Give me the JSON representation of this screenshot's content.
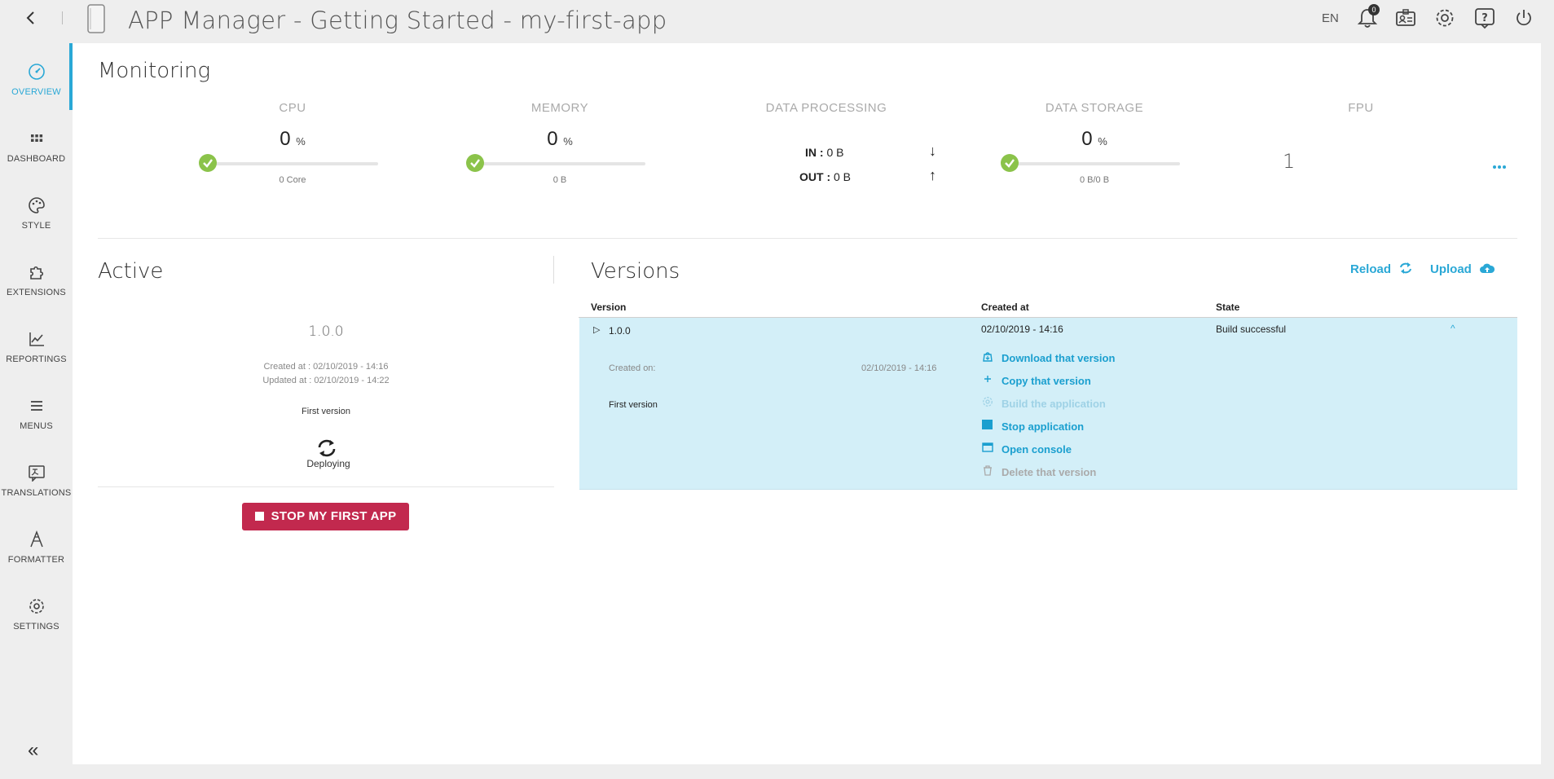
{
  "header": {
    "title": "APP Manager - Getting Started - my-first-app",
    "language": "EN",
    "notifications_count": "0"
  },
  "sidebar": {
    "items": [
      {
        "label": "OVERVIEW",
        "icon": "gauge-icon",
        "active": true
      },
      {
        "label": "DASHBOARD",
        "icon": "grid-icon"
      },
      {
        "label": "STYLE",
        "icon": "palette-icon"
      },
      {
        "label": "EXTENSIONS",
        "icon": "puzzle-icon"
      },
      {
        "label": "REPORTINGS",
        "icon": "chart-line-icon"
      },
      {
        "label": "MENUS",
        "icon": "menu-icon"
      },
      {
        "label": "TRANSLATIONS",
        "icon": "translate-icon"
      },
      {
        "label": "FORMATTER",
        "icon": "formatter-icon"
      },
      {
        "label": "SETTINGS",
        "icon": "gear-icon"
      }
    ],
    "collapse_label": "«"
  },
  "monitoring": {
    "title": "Monitoring",
    "cpu": {
      "label": "CPU",
      "value": "0",
      "unit": "%",
      "sub": "0 Core"
    },
    "memory": {
      "label": "MEMORY",
      "value": "0",
      "unit": "%",
      "sub": "0 B"
    },
    "data_processing": {
      "label": "DATA PROCESSING",
      "in_label": "IN :",
      "in_value": "0 B",
      "out_label": "OUT :",
      "out_value": "0 B",
      "in_arrow": "↓",
      "out_arrow": "↑"
    },
    "data_storage": {
      "label": "DATA STORAGE",
      "value": "0",
      "unit": "%",
      "sub": "0 B/0 B"
    },
    "fpu": {
      "label": "FPU",
      "value": "1"
    },
    "more": "•••"
  },
  "active": {
    "title": "Active",
    "version": "1.0.0",
    "created_at": "Created at  : 02/10/2019 - 14:16",
    "updated_at": "Updated at : 02/10/2019 - 14:22",
    "description": "First version",
    "status": "Deploying",
    "stop_button": "STOP MY FIRST APP"
  },
  "versions": {
    "title": "Versions",
    "reload_label": "Reload",
    "upload_label": "Upload",
    "columns": {
      "version": "Version",
      "created_at": "Created at",
      "state": "State"
    },
    "rows": [
      {
        "expand": "▷",
        "version": "1.0.0",
        "created_at": "02/10/2019 - 14:16",
        "state": "Build successful",
        "collapse": "^",
        "detail_created_label": "Created on:",
        "detail_created_value": "02/10/2019 - 14:16",
        "detail_description": "First version",
        "actions": [
          {
            "label": "Download that version",
            "icon": "download-icon",
            "state": "enabled"
          },
          {
            "label": "Copy that version",
            "icon": "plus-icon",
            "state": "enabled"
          },
          {
            "label": "Build the application",
            "icon": "gear-icon",
            "state": "disabled"
          },
          {
            "label": "Stop application",
            "icon": "stop-icon",
            "state": "enabled"
          },
          {
            "label": "Open console",
            "icon": "console-icon",
            "state": "enabled"
          },
          {
            "label": "Delete that version",
            "icon": "trash-icon",
            "state": "grey"
          }
        ]
      }
    ]
  },
  "colors": {
    "accent": "#2aa8d6",
    "ok": "#8bc34a",
    "danger": "#c2294e",
    "row_highlight": "#d3eff8"
  }
}
